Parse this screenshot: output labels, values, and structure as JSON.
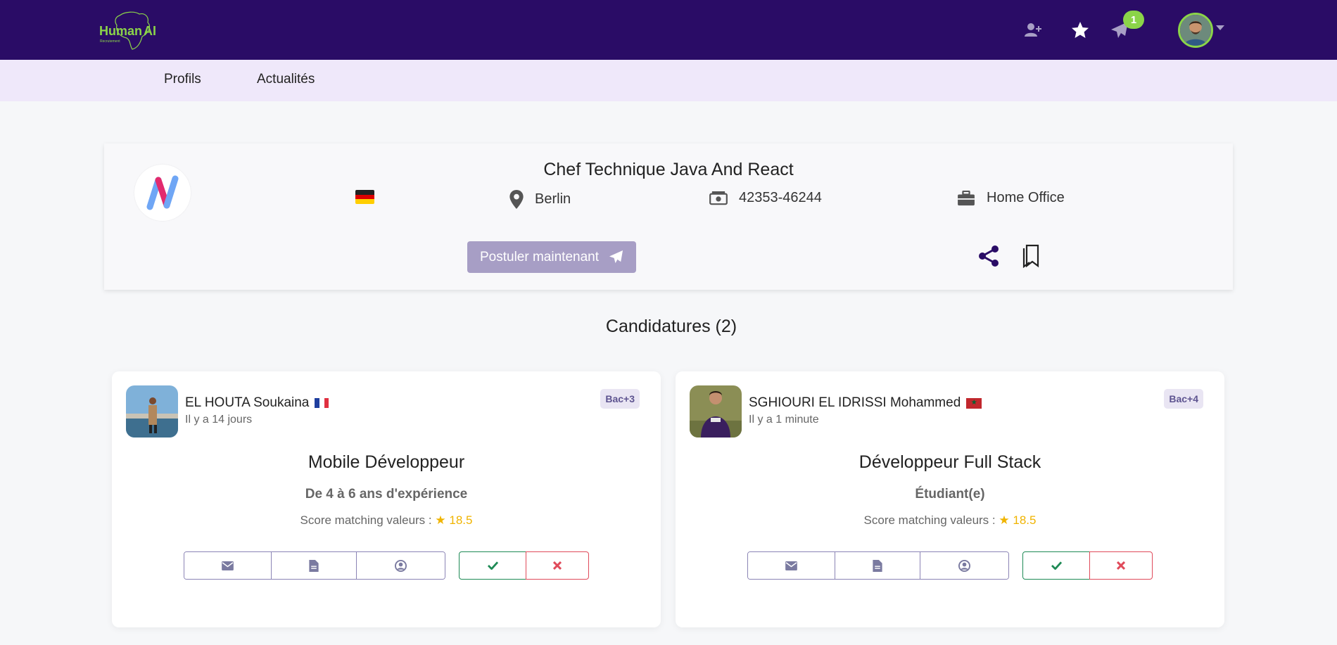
{
  "brand": {
    "logo_text": "Human AI",
    "logo_subtext": "Recrutement"
  },
  "header": {
    "icons": [
      "add-user-icon",
      "star-icon",
      "paper-plane-icon"
    ],
    "notification_count": "1",
    "colors": {
      "bar": "#2a0c66",
      "accent": "#8bd449"
    }
  },
  "nav": {
    "items": [
      {
        "label": "Profils"
      },
      {
        "label": "Actualités"
      }
    ]
  },
  "job": {
    "title": "Chef Technique Java And React",
    "country_flag": "Germany",
    "location": "Berlin",
    "salary": "42353-46244",
    "work_mode": "Home Office",
    "apply_label": "Postuler maintenant"
  },
  "applications": {
    "title": "Candidatures (2)"
  },
  "candidates": [
    {
      "name": "EL HOUTA Soukaina",
      "flag": "France",
      "time": "Il y a 14 jours",
      "degree": "Bac+3",
      "role": "Mobile Développeur",
      "experience": "De 4 à 6 ans d'expérience",
      "score_label": "Score matching valeurs :",
      "score": "18.5"
    },
    {
      "name": "SGHIOURI EL IDRISSI Mohammed",
      "flag": "Morocco",
      "time": "Il y a 1 minute",
      "degree": "Bac+4",
      "role": "Développeur Full Stack",
      "experience": "Étudiant(e)",
      "score_label": "Score matching valeurs :",
      "score": "18.5"
    }
  ]
}
